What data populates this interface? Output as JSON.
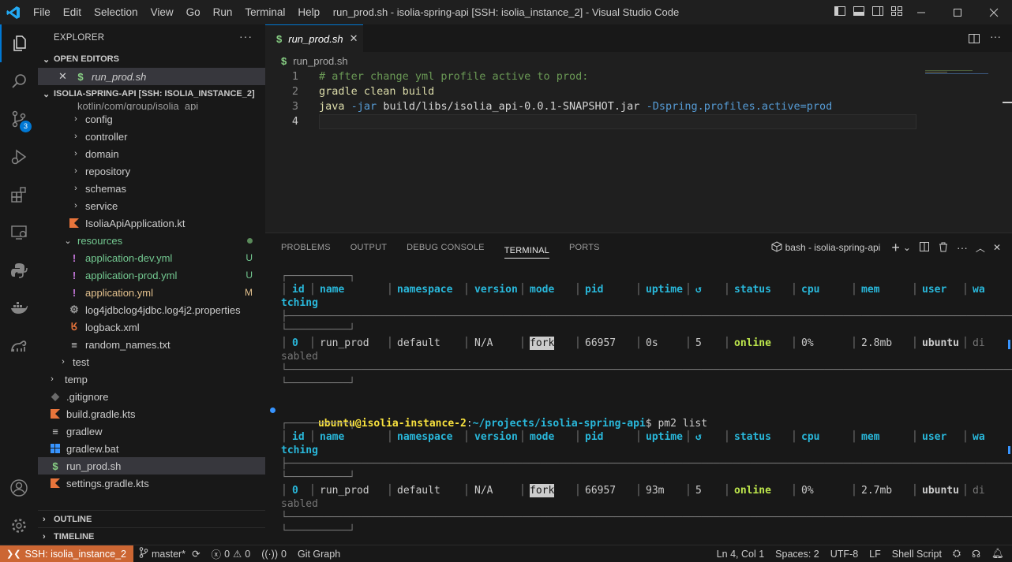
{
  "window": {
    "title": "run_prod.sh - isolia-spring-api [SSH: isolia_instance_2] - Visual Studio Code",
    "menu": [
      "File",
      "Edit",
      "Selection",
      "View",
      "Go",
      "Run",
      "Terminal",
      "Help"
    ]
  },
  "activity": {
    "scm_badge": "3"
  },
  "explorer": {
    "header": "EXPLORER",
    "open_editors": "OPEN EDITORS",
    "open_file": "run_prod.sh",
    "project": "ISOLIA-SPRING-API [SSH: ISOLIA_INSTANCE_2]",
    "partial_path": "kotlin/com/group/isolia_api",
    "folders": [
      "config",
      "controller",
      "domain",
      "repository",
      "schemas",
      "service"
    ],
    "kt_file": "IsoliaApiApplication.kt",
    "resources": "resources",
    "res_files": [
      {
        "name": "application-dev.yml",
        "status": "U"
      },
      {
        "name": "application-prod.yml",
        "status": "U"
      },
      {
        "name": "application.yml",
        "status": "M"
      }
    ],
    "props_file": "log4jdbclog4jdbc.log4j2.properties",
    "logback": "logback.xml",
    "random": "random_names.txt",
    "test": "test",
    "temp": "temp",
    "root_files": [
      ".gitignore",
      "build.gradle.kts",
      "gradlew",
      "gradlew.bat",
      "run_prod.sh",
      "settings.gradle.kts"
    ],
    "outline": "OUTLINE",
    "timeline": "TIMELINE"
  },
  "editor": {
    "tab": "run_prod.sh",
    "breadcrumb": "run_prod.sh",
    "line_numbers": [
      "1",
      "2",
      "3",
      "4"
    ],
    "line1": "# after change yml profile active to prod:",
    "line2": "gradle clean build",
    "line3_cmd": "java",
    "line3_flag": "-jar",
    "line3_arg": "build/libs/isolia_api-0.0.1-SNAPSHOT.jar",
    "line3_prop": "-Dspring.profiles.active=prod"
  },
  "panel": {
    "tabs": [
      "PROBLEMS",
      "OUTPUT",
      "DEBUG CONSOLE",
      "TERMINAL",
      "PORTS"
    ],
    "active_tab": "TERMINAL",
    "shell_label": "bash - isolia-spring-api"
  },
  "terminal": {
    "headers": [
      "id",
      "name",
      "namespace",
      "version",
      "mode",
      "pid",
      "uptime",
      "↺",
      "status",
      "cpu",
      "mem",
      "user",
      "wa"
    ],
    "header_wrap": "tching",
    "rows": [
      {
        "id": "0",
        "name": "run_prod",
        "namespace": "default",
        "version": "N/A",
        "mode": "fork",
        "pid": "66957",
        "uptime": "0s",
        "restarts": "5",
        "status": "online",
        "cpu": "0%",
        "mem": "2.8mb",
        "user": "ubuntu",
        "watch": "di",
        "watch_wrap": "sabled"
      },
      {
        "id": "0",
        "name": "run_prod",
        "namespace": "default",
        "version": "N/A",
        "mode": "fork",
        "pid": "66957",
        "uptime": "93m",
        "restarts": "5",
        "status": "online",
        "cpu": "0%",
        "mem": "2.7mb",
        "user": "ubuntu",
        "watch": "di",
        "watch_wrap": "sabled"
      }
    ],
    "prompt_user": "ubuntu@isolia-instance-2",
    "prompt_path": "~/projects/isolia-spring-api",
    "command": "pm2 list"
  },
  "status": {
    "remote": "SSH: isolia_instance_2",
    "branch": "master*",
    "errors": "0",
    "warnings": "0",
    "ports": "0",
    "git_graph": "Git Graph",
    "position": "Ln 4, Col 1",
    "spaces": "Spaces: 2",
    "encoding": "UTF-8",
    "eol": "LF",
    "language": "Shell Script"
  },
  "colors": {
    "accent": "#0078d4",
    "remote_bg": "#cc6633",
    "terminal_header": "#29b8db",
    "online": "#bde64c",
    "prompt_user": "#f9e23e",
    "prompt_path": "#29b8db",
    "yml_untracked": "#73c991",
    "yml_modified": "#e2c08d"
  }
}
